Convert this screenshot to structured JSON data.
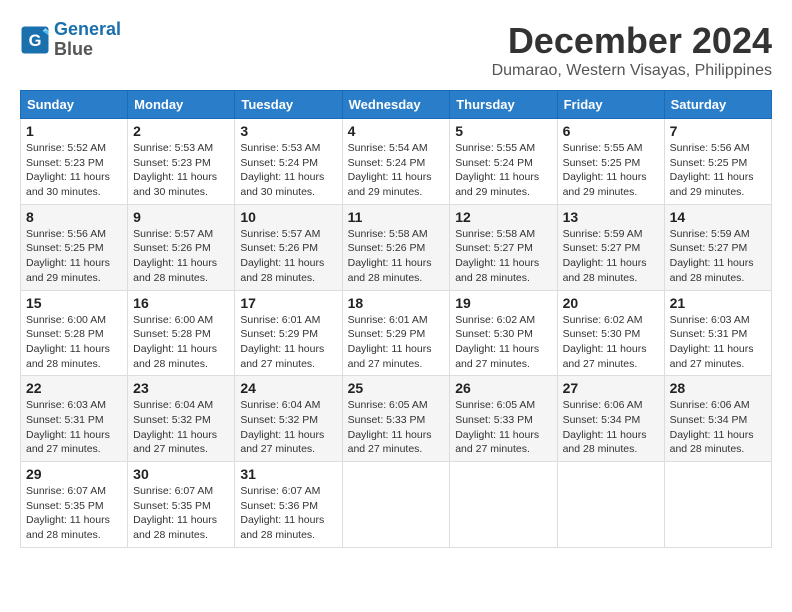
{
  "logo": {
    "line1": "General",
    "line2": "Blue"
  },
  "title": "December 2024",
  "location": "Dumarao, Western Visayas, Philippines",
  "headers": [
    "Sunday",
    "Monday",
    "Tuesday",
    "Wednesday",
    "Thursday",
    "Friday",
    "Saturday"
  ],
  "weeks": [
    [
      {
        "day": "1",
        "rise": "5:52 AM",
        "set": "5:23 PM",
        "daylight": "11 hours and 30 minutes."
      },
      {
        "day": "2",
        "rise": "5:53 AM",
        "set": "5:23 PM",
        "daylight": "11 hours and 30 minutes."
      },
      {
        "day": "3",
        "rise": "5:53 AM",
        "set": "5:24 PM",
        "daylight": "11 hours and 30 minutes."
      },
      {
        "day": "4",
        "rise": "5:54 AM",
        "set": "5:24 PM",
        "daylight": "11 hours and 29 minutes."
      },
      {
        "day": "5",
        "rise": "5:55 AM",
        "set": "5:24 PM",
        "daylight": "11 hours and 29 minutes."
      },
      {
        "day": "6",
        "rise": "5:55 AM",
        "set": "5:25 PM",
        "daylight": "11 hours and 29 minutes."
      },
      {
        "day": "7",
        "rise": "5:56 AM",
        "set": "5:25 PM",
        "daylight": "11 hours and 29 minutes."
      }
    ],
    [
      {
        "day": "8",
        "rise": "5:56 AM",
        "set": "5:25 PM",
        "daylight": "11 hours and 29 minutes."
      },
      {
        "day": "9",
        "rise": "5:57 AM",
        "set": "5:26 PM",
        "daylight": "11 hours and 28 minutes."
      },
      {
        "day": "10",
        "rise": "5:57 AM",
        "set": "5:26 PM",
        "daylight": "11 hours and 28 minutes."
      },
      {
        "day": "11",
        "rise": "5:58 AM",
        "set": "5:26 PM",
        "daylight": "11 hours and 28 minutes."
      },
      {
        "day": "12",
        "rise": "5:58 AM",
        "set": "5:27 PM",
        "daylight": "11 hours and 28 minutes."
      },
      {
        "day": "13",
        "rise": "5:59 AM",
        "set": "5:27 PM",
        "daylight": "11 hours and 28 minutes."
      },
      {
        "day": "14",
        "rise": "5:59 AM",
        "set": "5:27 PM",
        "daylight": "11 hours and 28 minutes."
      }
    ],
    [
      {
        "day": "15",
        "rise": "6:00 AM",
        "set": "5:28 PM",
        "daylight": "11 hours and 28 minutes."
      },
      {
        "day": "16",
        "rise": "6:00 AM",
        "set": "5:28 PM",
        "daylight": "11 hours and 28 minutes."
      },
      {
        "day": "17",
        "rise": "6:01 AM",
        "set": "5:29 PM",
        "daylight": "11 hours and 27 minutes."
      },
      {
        "day": "18",
        "rise": "6:01 AM",
        "set": "5:29 PM",
        "daylight": "11 hours and 27 minutes."
      },
      {
        "day": "19",
        "rise": "6:02 AM",
        "set": "5:30 PM",
        "daylight": "11 hours and 27 minutes."
      },
      {
        "day": "20",
        "rise": "6:02 AM",
        "set": "5:30 PM",
        "daylight": "11 hours and 27 minutes."
      },
      {
        "day": "21",
        "rise": "6:03 AM",
        "set": "5:31 PM",
        "daylight": "11 hours and 27 minutes."
      }
    ],
    [
      {
        "day": "22",
        "rise": "6:03 AM",
        "set": "5:31 PM",
        "daylight": "11 hours and 27 minutes."
      },
      {
        "day": "23",
        "rise": "6:04 AM",
        "set": "5:32 PM",
        "daylight": "11 hours and 27 minutes."
      },
      {
        "day": "24",
        "rise": "6:04 AM",
        "set": "5:32 PM",
        "daylight": "11 hours and 27 minutes."
      },
      {
        "day": "25",
        "rise": "6:05 AM",
        "set": "5:33 PM",
        "daylight": "11 hours and 27 minutes."
      },
      {
        "day": "26",
        "rise": "6:05 AM",
        "set": "5:33 PM",
        "daylight": "11 hours and 27 minutes."
      },
      {
        "day": "27",
        "rise": "6:06 AM",
        "set": "5:34 PM",
        "daylight": "11 hours and 28 minutes."
      },
      {
        "day": "28",
        "rise": "6:06 AM",
        "set": "5:34 PM",
        "daylight": "11 hours and 28 minutes."
      }
    ],
    [
      {
        "day": "29",
        "rise": "6:07 AM",
        "set": "5:35 PM",
        "daylight": "11 hours and 28 minutes."
      },
      {
        "day": "30",
        "rise": "6:07 AM",
        "set": "5:35 PM",
        "daylight": "11 hours and 28 minutes."
      },
      {
        "day": "31",
        "rise": "6:07 AM",
        "set": "5:36 PM",
        "daylight": "11 hours and 28 minutes."
      },
      null,
      null,
      null,
      null
    ]
  ]
}
